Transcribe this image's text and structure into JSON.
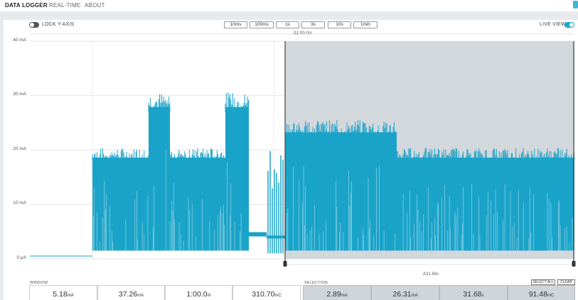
{
  "nav": {
    "items": [
      "DATA LOGGER",
      "REAL-TIME",
      "ABOUT"
    ]
  },
  "controls": {
    "lock_y_axis": "LOCK Y-AXIS",
    "live_view": "LIVE VIEW",
    "zoom_buttons": [
      "10ms",
      "100ms",
      "1s",
      "3s",
      "10s",
      "1min"
    ]
  },
  "window_span": "Δ1:00.0m",
  "selection_span": "Δ31.68s",
  "y_ticks": [
    "40 mA",
    "30 mA",
    "20 mA",
    "10 mA",
    "0 μA"
  ],
  "window": {
    "label": "WINDOW",
    "stats": [
      {
        "value": "5.18",
        "unit": "mA",
        "label": "average"
      },
      {
        "value": "37.26",
        "unit": "mA",
        "label": "max"
      },
      {
        "value": "1:00.0",
        "unit": "m",
        "label": "time"
      },
      {
        "value": "310.70",
        "unit": "mC",
        "label": "charge"
      }
    ]
  },
  "selection": {
    "label": "SELECTION",
    "select_all": "SELECT ALL",
    "clear": "CLEAR",
    "stats": [
      {
        "value": "2.89",
        "unit": "mA",
        "label": "average"
      },
      {
        "value": "26.31",
        "unit": "mA",
        "label": "max"
      },
      {
        "value": "31.68",
        "unit": "s",
        "label": "time"
      },
      {
        "value": "91.48",
        "unit": "mC",
        "label": "charge"
      }
    ]
  },
  "colors": {
    "signal": "#1aa3c9",
    "accent": "#1fa8cf",
    "selection_bg": "#d3d8dc",
    "toggle_off": "#555555"
  },
  "chart_data": {
    "type": "line",
    "ylim": [
      0,
      40
    ],
    "y_unit": "mA",
    "segments": [
      {
        "desc": "idle",
        "level": 0.5
      },
      {
        "desc": "active",
        "level_min": 0.5,
        "level_max": 20
      },
      {
        "desc": "burst",
        "level_min": 0.5,
        "level_max": 30
      },
      {
        "desc": "active",
        "level_min": 0.5,
        "level_max": 20
      },
      {
        "desc": "burst",
        "level_min": 0.5,
        "level_max": 30
      },
      {
        "desc": "low",
        "level": 4.5
      },
      {
        "desc": "spikes",
        "level_max": 21
      },
      {
        "desc": "selection_high",
        "level_min": 0.5,
        "level_max": 25
      },
      {
        "desc": "selection_mid",
        "level_min": 0.5,
        "level_max": 20
      }
    ]
  }
}
